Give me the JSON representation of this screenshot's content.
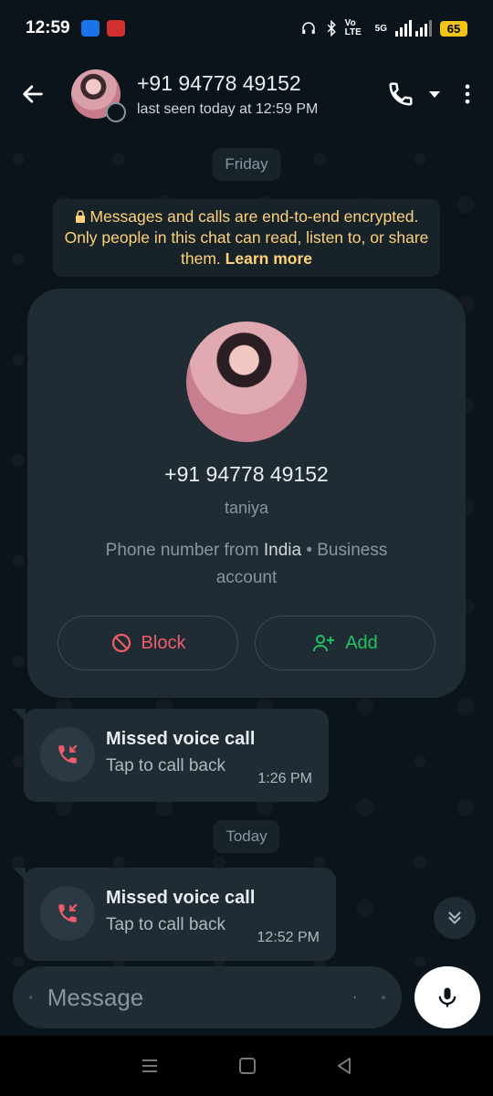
{
  "status_bar": {
    "time": "12:59",
    "network_label": "Vo LTE",
    "signal_label": "5G",
    "battery": "65"
  },
  "header": {
    "contact_phone": "+91 94778 49152",
    "last_seen": "last seen today at 12:59 PM"
  },
  "chat": {
    "date_chip_1": "Friday",
    "encryption_text": "Messages and calls are end-to-end encrypted. Only people in this chat can read, listen to, or share them.",
    "encryption_link": "Learn more",
    "contact_card": {
      "phone": "+91 94778 49152",
      "name": "taniya",
      "desc_prefix": "Phone number from",
      "desc_country": "India",
      "desc_suffix": "• Business account",
      "block_label": "Block",
      "add_label": "Add"
    },
    "calls": [
      {
        "title": "Missed voice call",
        "subtitle": "Tap to call back",
        "time": "1:26 PM"
      },
      {
        "title": "Missed voice call",
        "subtitle": "Tap to call back",
        "time": "12:52 PM"
      }
    ],
    "date_chip_2": "Today"
  },
  "composer": {
    "placeholder": "Message"
  },
  "colors": {
    "background": "#0b141a",
    "bubble": "#1f2c33",
    "block_red": "#f15c6d",
    "add_green": "#21c063",
    "encryption_yellow": "#ffd279"
  }
}
